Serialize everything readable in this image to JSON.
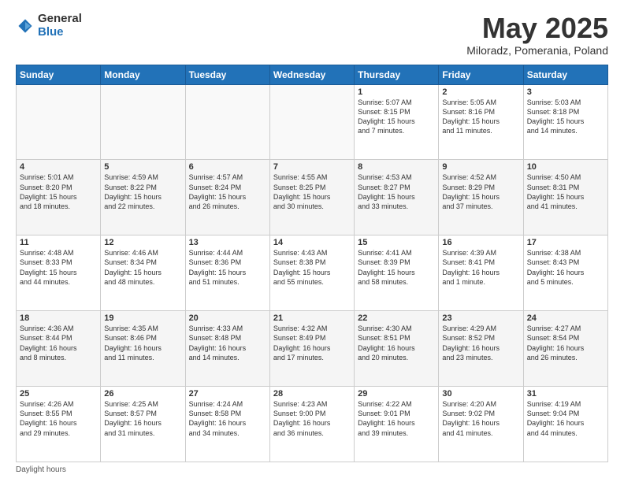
{
  "logo": {
    "general": "General",
    "blue": "Blue"
  },
  "title": "May 2025",
  "subtitle": "Miloradz, Pomerania, Poland",
  "days_of_week": [
    "Sunday",
    "Monday",
    "Tuesday",
    "Wednesday",
    "Thursday",
    "Friday",
    "Saturday"
  ],
  "weeks": [
    [
      {
        "day": "",
        "info": ""
      },
      {
        "day": "",
        "info": ""
      },
      {
        "day": "",
        "info": ""
      },
      {
        "day": "",
        "info": ""
      },
      {
        "day": "1",
        "info": "Sunrise: 5:07 AM\nSunset: 8:15 PM\nDaylight: 15 hours\nand 7 minutes."
      },
      {
        "day": "2",
        "info": "Sunrise: 5:05 AM\nSunset: 8:16 PM\nDaylight: 15 hours\nand 11 minutes."
      },
      {
        "day": "3",
        "info": "Sunrise: 5:03 AM\nSunset: 8:18 PM\nDaylight: 15 hours\nand 14 minutes."
      }
    ],
    [
      {
        "day": "4",
        "info": "Sunrise: 5:01 AM\nSunset: 8:20 PM\nDaylight: 15 hours\nand 18 minutes."
      },
      {
        "day": "5",
        "info": "Sunrise: 4:59 AM\nSunset: 8:22 PM\nDaylight: 15 hours\nand 22 minutes."
      },
      {
        "day": "6",
        "info": "Sunrise: 4:57 AM\nSunset: 8:24 PM\nDaylight: 15 hours\nand 26 minutes."
      },
      {
        "day": "7",
        "info": "Sunrise: 4:55 AM\nSunset: 8:25 PM\nDaylight: 15 hours\nand 30 minutes."
      },
      {
        "day": "8",
        "info": "Sunrise: 4:53 AM\nSunset: 8:27 PM\nDaylight: 15 hours\nand 33 minutes."
      },
      {
        "day": "9",
        "info": "Sunrise: 4:52 AM\nSunset: 8:29 PM\nDaylight: 15 hours\nand 37 minutes."
      },
      {
        "day": "10",
        "info": "Sunrise: 4:50 AM\nSunset: 8:31 PM\nDaylight: 15 hours\nand 41 minutes."
      }
    ],
    [
      {
        "day": "11",
        "info": "Sunrise: 4:48 AM\nSunset: 8:33 PM\nDaylight: 15 hours\nand 44 minutes."
      },
      {
        "day": "12",
        "info": "Sunrise: 4:46 AM\nSunset: 8:34 PM\nDaylight: 15 hours\nand 48 minutes."
      },
      {
        "day": "13",
        "info": "Sunrise: 4:44 AM\nSunset: 8:36 PM\nDaylight: 15 hours\nand 51 minutes."
      },
      {
        "day": "14",
        "info": "Sunrise: 4:43 AM\nSunset: 8:38 PM\nDaylight: 15 hours\nand 55 minutes."
      },
      {
        "day": "15",
        "info": "Sunrise: 4:41 AM\nSunset: 8:39 PM\nDaylight: 15 hours\nand 58 minutes."
      },
      {
        "day": "16",
        "info": "Sunrise: 4:39 AM\nSunset: 8:41 PM\nDaylight: 16 hours\nand 1 minute."
      },
      {
        "day": "17",
        "info": "Sunrise: 4:38 AM\nSunset: 8:43 PM\nDaylight: 16 hours\nand 5 minutes."
      }
    ],
    [
      {
        "day": "18",
        "info": "Sunrise: 4:36 AM\nSunset: 8:44 PM\nDaylight: 16 hours\nand 8 minutes."
      },
      {
        "day": "19",
        "info": "Sunrise: 4:35 AM\nSunset: 8:46 PM\nDaylight: 16 hours\nand 11 minutes."
      },
      {
        "day": "20",
        "info": "Sunrise: 4:33 AM\nSunset: 8:48 PM\nDaylight: 16 hours\nand 14 minutes."
      },
      {
        "day": "21",
        "info": "Sunrise: 4:32 AM\nSunset: 8:49 PM\nDaylight: 16 hours\nand 17 minutes."
      },
      {
        "day": "22",
        "info": "Sunrise: 4:30 AM\nSunset: 8:51 PM\nDaylight: 16 hours\nand 20 minutes."
      },
      {
        "day": "23",
        "info": "Sunrise: 4:29 AM\nSunset: 8:52 PM\nDaylight: 16 hours\nand 23 minutes."
      },
      {
        "day": "24",
        "info": "Sunrise: 4:27 AM\nSunset: 8:54 PM\nDaylight: 16 hours\nand 26 minutes."
      }
    ],
    [
      {
        "day": "25",
        "info": "Sunrise: 4:26 AM\nSunset: 8:55 PM\nDaylight: 16 hours\nand 29 minutes."
      },
      {
        "day": "26",
        "info": "Sunrise: 4:25 AM\nSunset: 8:57 PM\nDaylight: 16 hours\nand 31 minutes."
      },
      {
        "day": "27",
        "info": "Sunrise: 4:24 AM\nSunset: 8:58 PM\nDaylight: 16 hours\nand 34 minutes."
      },
      {
        "day": "28",
        "info": "Sunrise: 4:23 AM\nSunset: 9:00 PM\nDaylight: 16 hours\nand 36 minutes."
      },
      {
        "day": "29",
        "info": "Sunrise: 4:22 AM\nSunset: 9:01 PM\nDaylight: 16 hours\nand 39 minutes."
      },
      {
        "day": "30",
        "info": "Sunrise: 4:20 AM\nSunset: 9:02 PM\nDaylight: 16 hours\nand 41 minutes."
      },
      {
        "day": "31",
        "info": "Sunrise: 4:19 AM\nSunset: 9:04 PM\nDaylight: 16 hours\nand 44 minutes."
      }
    ]
  ],
  "footer": "Daylight hours"
}
